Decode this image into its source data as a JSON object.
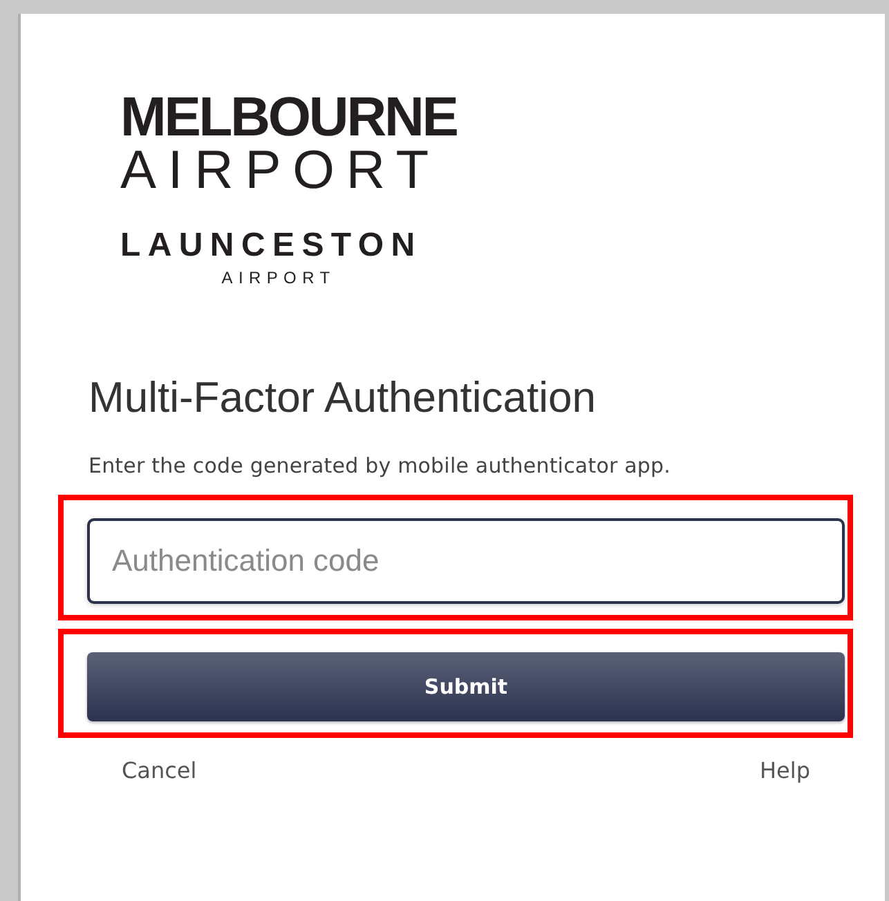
{
  "logo": {
    "primary": {
      "name": "MELBOURNE",
      "suffix": "AIRPORT"
    },
    "secondary": {
      "name": "LAUNCESTON",
      "suffix": "AIRPORT"
    }
  },
  "form": {
    "title": "Multi-Factor Authentication",
    "instructions": "Enter the code generated by mobile authenticator app.",
    "code_field": {
      "placeholder": "Authentication code",
      "highlighted": true
    },
    "submit": {
      "label": "Submit",
      "highlighted": true
    },
    "links": [
      "Cancel",
      "Help"
    ]
  }
}
